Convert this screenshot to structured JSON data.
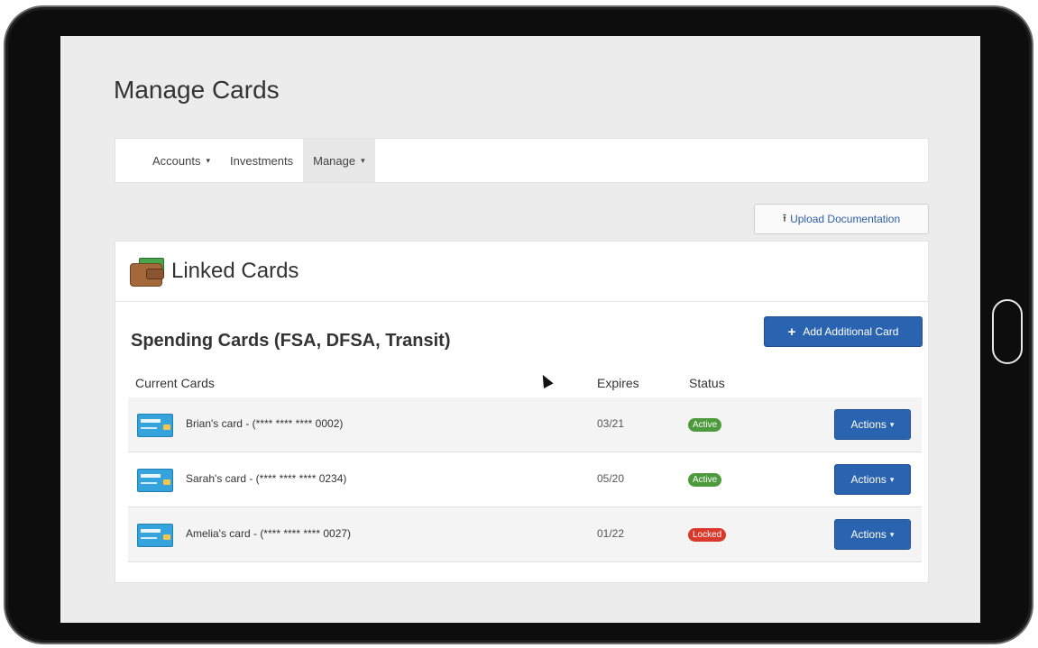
{
  "page": {
    "title": "Manage Cards"
  },
  "nav": {
    "items": [
      {
        "label": "Accounts",
        "has_caret": true,
        "active": false
      },
      {
        "label": "Investments",
        "has_caret": false,
        "active": false
      },
      {
        "label": "Manage",
        "has_caret": true,
        "active": true
      }
    ],
    "caret_glyph": "▾"
  },
  "toolbar": {
    "upload_label": "Upload Documentation",
    "upload_icon": "upload-icon"
  },
  "panel": {
    "title": "Linked Cards",
    "icon": "wallet-icon",
    "section_title": "Spending Cards (FSA, DFSA, Transit)",
    "add_label": "Add Additional Card",
    "add_icon": "plus-icon"
  },
  "table": {
    "columns": [
      "Current Cards",
      "Expires",
      "Status"
    ],
    "rows": [
      {
        "card": "Brian's card - (**** **** **** 0002)",
        "expires": "03/21",
        "status": "Active",
        "action": "Actions"
      },
      {
        "card": "Sarah's card - (**** **** **** 0234)",
        "expires": "05/20",
        "status": "Active",
        "action": "Actions"
      },
      {
        "card": "Amelia's card - (**** **** **** 0027)",
        "expires": "01/22",
        "status": "Locked",
        "action": "Actions"
      }
    ]
  },
  "colors": {
    "primary": "#2a64b1",
    "active_status": "#4c9a3c",
    "locked_status": "#d9382a",
    "link": "#2d5ea7"
  }
}
